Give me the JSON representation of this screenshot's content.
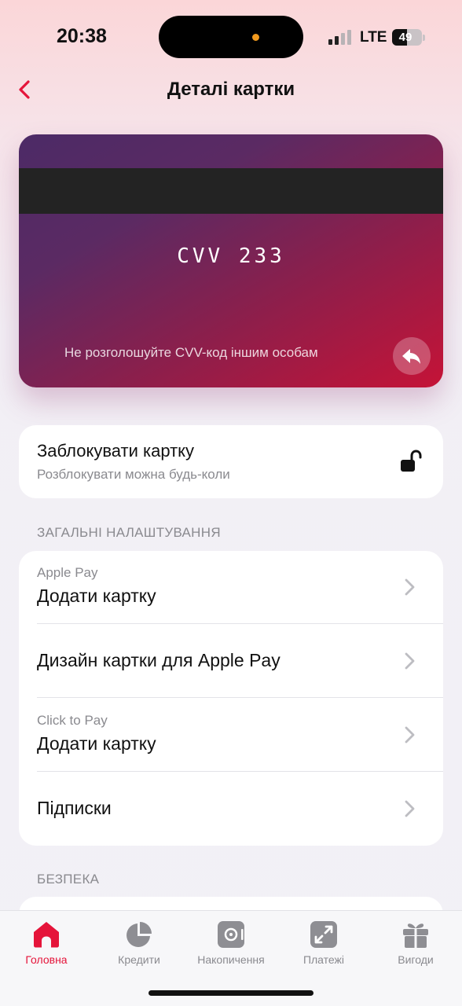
{
  "status_bar": {
    "time": "20:38",
    "network": "LTE",
    "battery": "49",
    "battery_level": 0.49,
    "recording_dot_color": "#f29a1e"
  },
  "nav": {
    "back_icon": "chevron-left-icon",
    "title": "Деталі картки"
  },
  "card": {
    "cvv": "CVV 233",
    "note": "Не розголошуйте CVV-код іншим особам",
    "flip_icon": "reply-arrow-icon"
  },
  "block": {
    "title": "Заблокувати картку",
    "subtitle": "Розблокувати можна будь-коли",
    "icon": "unlocked-padlock-icon"
  },
  "general_settings": {
    "label": "ЗАГАЛЬНІ НАЛАШТУВАННЯ",
    "rows": [
      {
        "subtitle": "Apple Pay",
        "title": "Додати картку"
      },
      {
        "subtitle": "",
        "title": "Дизайн картки для Apple Pay"
      },
      {
        "subtitle": "Click to Pay",
        "title": "Додати картку"
      },
      {
        "subtitle": "",
        "title": "Підписки"
      }
    ]
  },
  "security": {
    "label": "БЕЗПЕКА"
  },
  "tabs": [
    {
      "label": "Головна",
      "icon": "home-icon",
      "active": true
    },
    {
      "label": "Кредити",
      "icon": "pie-chart-icon",
      "active": false
    },
    {
      "label": "Накопичення",
      "icon": "safe-icon",
      "active": false
    },
    {
      "label": "Платежі",
      "icon": "transfer-arrows-icon",
      "active": false
    },
    {
      "label": "Вигоди",
      "icon": "gift-icon",
      "active": false
    }
  ],
  "colors": {
    "accent": "#e5143a",
    "card_gradient_start": "#4c2a66",
    "card_gradient_end": "#c51337"
  }
}
